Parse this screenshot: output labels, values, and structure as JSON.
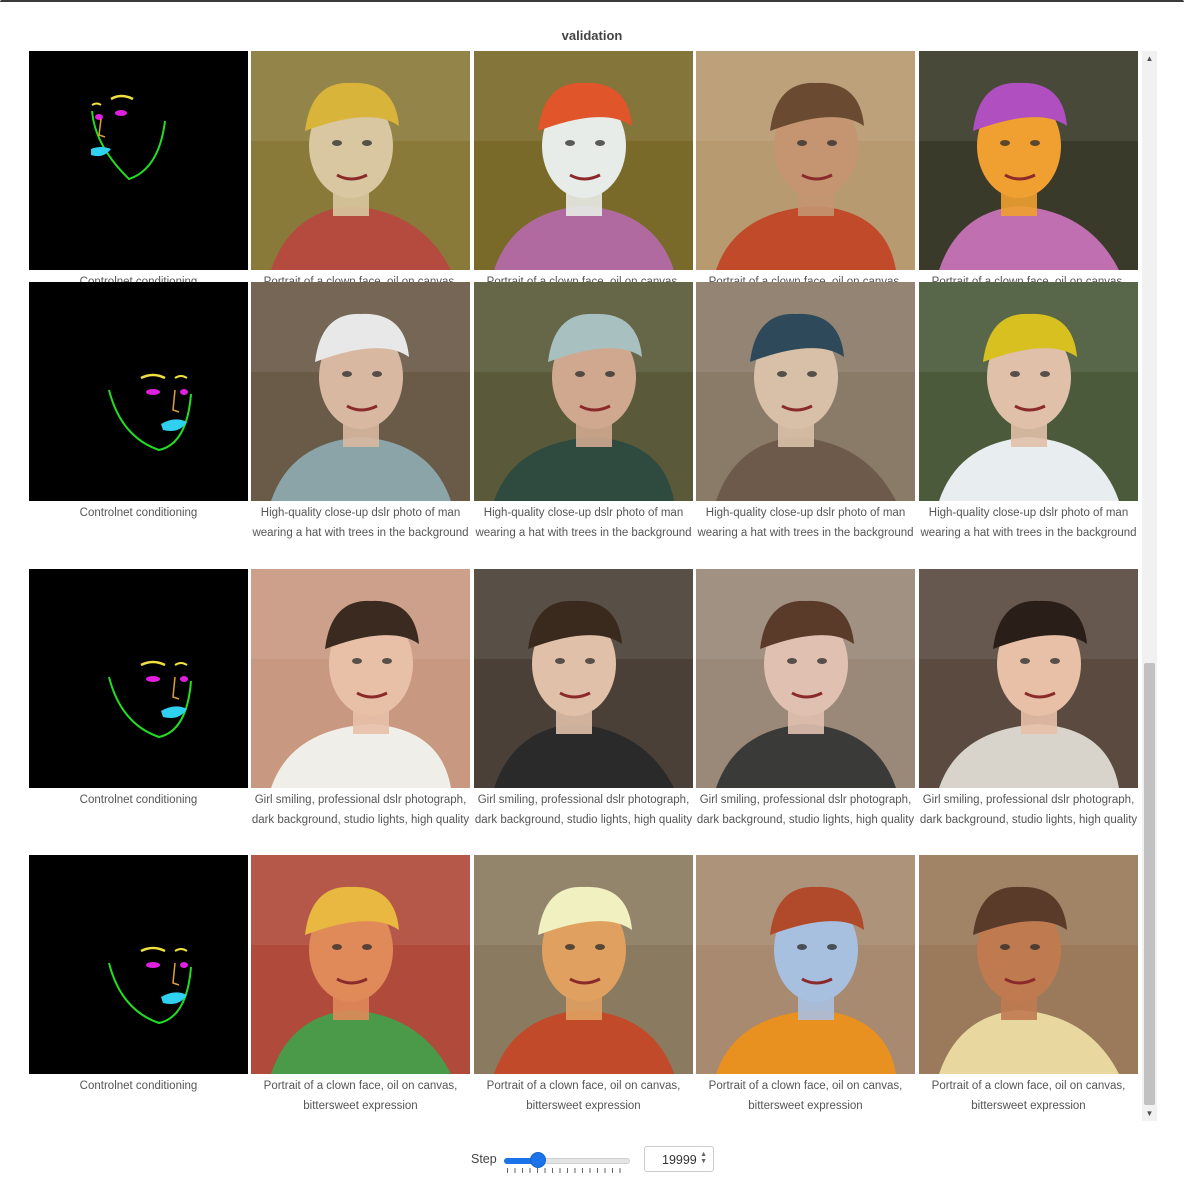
{
  "panel": {
    "title": "validation"
  },
  "rows": [
    {
      "conditioning_caption": "Controlnet conditioning",
      "samples": [
        {
          "caption": "Portrait of a clown face, oil on canvas, bittersweet expression",
          "bg": "#8a7a3a",
          "face": "#d8c7a0",
          "hair": "#d9b43a",
          "shirt": "#b54a3e"
        },
        {
          "caption": "Portrait of a clown face, oil on canvas, bittersweet expression",
          "bg": "#7a6a2a",
          "face": "#e8ece8",
          "hair": "#e0552a",
          "shirt": "#b06aa0"
        },
        {
          "caption": "Portrait of a clown face, oil on canvas, bittersweet expression",
          "bg": "#b89a70",
          "face": "#c49570",
          "hair": "#6a4a30",
          "shirt": "#c04a2a"
        },
        {
          "caption": "Portrait of a clown face, oil on canvas, bittersweet expression",
          "bg": "#3a3a2a",
          "face": "#f0a030",
          "hair": "#b050c0",
          "shirt": "#c070b0"
        }
      ]
    },
    {
      "conditioning_caption": "Controlnet conditioning",
      "samples": [
        {
          "caption": "High-quality close-up dslr photo of man wearing a hat with trees in the background",
          "bg": "#6a5a48",
          "face": "#d8b8a0",
          "hair": "#e8e8e8",
          "shirt": "#8aa4a8"
        },
        {
          "caption": "High-quality close-up dslr photo of man wearing a hat with trees in the background",
          "bg": "#5a5a3a",
          "face": "#d0a890",
          "hair": "#a8c0c0",
          "shirt": "#2f4a3e"
        },
        {
          "caption": "High-quality close-up dslr photo of man wearing a hat with trees in the background",
          "bg": "#8a7a68",
          "face": "#d8c0a8",
          "hair": "#2e4a5a",
          "shirt": "#6e5a4a"
        },
        {
          "caption": "High-quality close-up dslr photo of man wearing a hat with trees in the background",
          "bg": "#4a5a3a",
          "face": "#e0c0a8",
          "hair": "#d8c020",
          "shirt": "#e8eef0"
        }
      ]
    },
    {
      "conditioning_caption": "Controlnet conditioning",
      "samples": [
        {
          "caption": "Girl smiling, professional dslr photograph, dark background, studio lights, high quality",
          "bg": "#c89880",
          "face": "#e8c0a8",
          "hair": "#3a2a20",
          "shirt": "#f0eee8"
        },
        {
          "caption": "Girl smiling, professional dslr photograph, dark background, studio lights, high quality",
          "bg": "#4a4038",
          "face": "#e0c0a8",
          "hair": "#3a2a1e",
          "shirt": "#2a2a2a"
        },
        {
          "caption": "Girl smiling, professional dslr photograph, dark background, studio lights, high quality",
          "bg": "#9a8878",
          "face": "#e0c0b0",
          "hair": "#5a3a28",
          "shirt": "#3a3a38"
        },
        {
          "caption": "Girl smiling, professional dslr photograph, dark background, studio lights, high quality",
          "bg": "#5a4a40",
          "face": "#e8c0a8",
          "hair": "#2a1e18",
          "shirt": "#d8d4cc"
        }
      ]
    },
    {
      "conditioning_caption": "Controlnet conditioning",
      "samples": [
        {
          "caption": "Portrait of a clown face, oil on canvas, bittersweet expression",
          "bg": "#b04a3a",
          "face": "#e08a5a",
          "hair": "#e8b840",
          "shirt": "#4a9a4a"
        },
        {
          "caption": "Portrait of a clown face, oil on canvas, bittersweet expression",
          "bg": "#8a7a60",
          "face": "#e0a060",
          "hair": "#f0f0c0",
          "shirt": "#c04a2a"
        },
        {
          "caption": "Portrait of a clown face, oil on canvas, bittersweet expression",
          "bg": "#a88a70",
          "face": "#a8c0e0",
          "hair": "#b04a2a",
          "shirt": "#e89020"
        },
        {
          "caption": "Portrait of a clown face, oil on canvas, bittersweet expression",
          "bg": "#9a7a5a",
          "face": "#c07a50",
          "hair": "#5a3a28",
          "shirt": "#e8d8a0"
        }
      ]
    }
  ],
  "step": {
    "label": "Step",
    "value": "19999",
    "slider_fraction": 0.25
  },
  "icons": {
    "scroll_up": "scroll-up-arrow-icon",
    "scroll_down": "scroll-down-arrow-icon",
    "spinner": "spinner-arrows-icon"
  }
}
